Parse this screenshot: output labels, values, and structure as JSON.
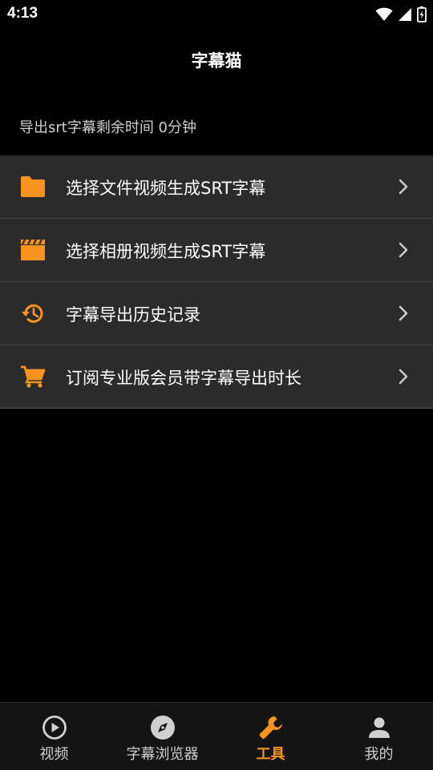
{
  "status_bar": {
    "time": "4:13",
    "icons": [
      "wifi-icon",
      "signal-icon",
      "battery-icon"
    ]
  },
  "header": {
    "title": "字幕猫"
  },
  "info": {
    "remaining_text": "导出srt字幕剩余时间 0分钟"
  },
  "menu": {
    "items": [
      {
        "label": "选择文件视频生成SRT字幕",
        "icon": "folder-icon"
      },
      {
        "label": "选择相册视频生成SRT字幕",
        "icon": "clapperboard-icon"
      },
      {
        "label": "字幕导出历史记录",
        "icon": "history-icon"
      },
      {
        "label": "订阅专业版会员带字幕导出时长",
        "icon": "cart-icon"
      }
    ]
  },
  "bottom_nav": {
    "items": [
      {
        "label": "视频",
        "icon": "play-circle-icon",
        "active": false
      },
      {
        "label": "字幕浏览器",
        "icon": "compass-icon",
        "active": false
      },
      {
        "label": "工具",
        "icon": "wrench-icon",
        "active": true
      },
      {
        "label": "我的",
        "icon": "person-icon",
        "active": false
      }
    ]
  },
  "colors": {
    "accent": "#f7931e",
    "background": "#000000",
    "menu_background": "#2b2b2b",
    "nav_inactive": "#d0d0d0"
  }
}
